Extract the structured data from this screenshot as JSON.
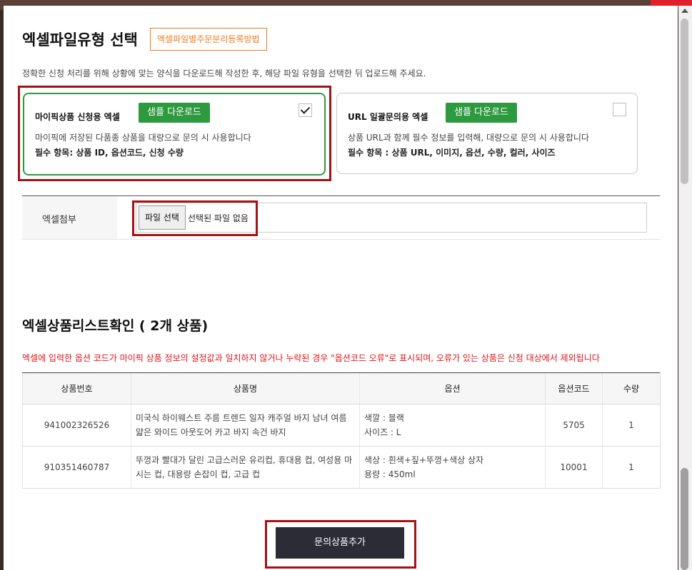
{
  "header": {
    "title": "엑셀파일유형 선택",
    "guide_button": "엑셀파일별주문분리등록방법",
    "description": "정확한 신청 처리를 위해 상황에 맞는 양식을 다운로드해 작성한 후, 해당 파일 유형을 선택한 뒤 업로드해 주세요."
  },
  "cards": [
    {
      "title": "마이픽상품 신청용 엑셀",
      "sample_button": "샘플 다운로드",
      "desc": "마이픽에 저장된 다품종 상품을 대량으로 문의 시 사용합니다",
      "required": "필수 항목: 상품 ID, 옵션코드, 신청 수량",
      "checked": true
    },
    {
      "title": "URL 일괄문의용 엑셀",
      "sample_button": "샘플 다운로드",
      "desc": "상품 URL과 함께 필수 정보를 입력해, 대량으로 문의 시 사용합니다",
      "required": "필수 항목 : 상품 URL, 이미지, 옵션, 수량, 컬러, 사이즈",
      "checked": false
    }
  ],
  "attach": {
    "label": "엑셀첨부",
    "file_button": "파일 선택",
    "file_status": "선택된 파일 없음"
  },
  "list": {
    "title": "엑셀상품리스트확인 ( 2개 상품)",
    "warning": "엑셀에 입력한 옵션 코드가 마이픽 상품 정보의 설정값과 일치하지 않거나 누락된 경우 \"옵션코드 오류\"로 표시되며, 오류가 있는 상품은 신청 대상에서 제외됩니다",
    "columns": [
      "상품번호",
      "상품명",
      "옵션",
      "옵션코드",
      "수량"
    ],
    "rows": [
      {
        "product_no": "941002326526",
        "name": "미국식 하이웨스트 주름 트렌드 일자 캐주얼 바지 남녀 여름 얇은 와이드 아웃도어 카고 바지 속건 바지",
        "option_1": "색깔 : 블랙",
        "option_2": "사이즈 : L",
        "option_code": "5705",
        "qty": "1"
      },
      {
        "product_no": "910351460787",
        "name": "뚜껑과 빨대가 달린 고급스러운 유리컵, 휴대용 컵, 여성용 마시는 컵, 대용량 손잡이 컵, 고급 컵",
        "option_1": "색상 : 흰색+짚+뚜껑+색상 상자",
        "option_2": "용량 : 450ml",
        "option_code": "10001",
        "qty": "1"
      }
    ]
  },
  "footer": {
    "add_button": "문의상품추가"
  },
  "colors": {
    "accent_green": "#2e9a3f",
    "accent_orange": "#f07b1b",
    "highlight_red": "#a41215",
    "warning_red": "#e0151b",
    "dark_button": "#2b2c36"
  }
}
